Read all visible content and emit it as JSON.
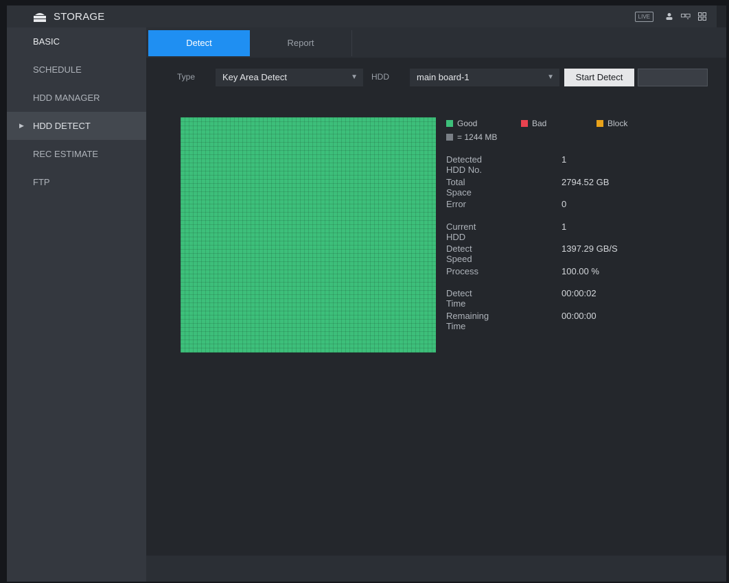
{
  "header": {
    "title": "STORAGE",
    "badge": "LIVE",
    "icons": [
      "storage-icon",
      "user-icon",
      "dual-screen-icon",
      "grid-icon"
    ],
    "colors": {
      "bar_bg": "#2e3238",
      "title_text": "#e8eaed"
    }
  },
  "sidebar": {
    "items": [
      {
        "label": "BASIC"
      },
      {
        "label": "SCHEDULE"
      },
      {
        "label": "HDD MANAGER"
      },
      {
        "label": "HDD DETECT",
        "active": true
      },
      {
        "label": "REC ESTIMATE"
      },
      {
        "label": "FTP"
      }
    ]
  },
  "tabs": [
    {
      "label": "Detect",
      "active": true
    },
    {
      "label": "Report",
      "active": false
    }
  ],
  "filters": {
    "type_label": "Type",
    "type_value": "Key Area Detect",
    "hdd_label": "HDD",
    "hdd_value": "main board-1",
    "start_label": "Start Detect",
    "stop_label": ""
  },
  "legend": {
    "good": "Good",
    "bad": "Bad",
    "block": "Block",
    "scale": "= 1244 MB",
    "colors": {
      "good": "#3dbf7a",
      "bad": "#e8424f",
      "block": "#e8a21a",
      "scale": "#7a7f86"
    }
  },
  "info": [
    {
      "label": "Detected HDD No.",
      "value": "1"
    },
    {
      "label": "Total Space",
      "value": "2794.52 GB"
    },
    {
      "label": "Error",
      "value": "0"
    },
    {
      "label": "Current HDD",
      "value": "1"
    },
    {
      "label": "Detect Speed",
      "value": "1397.29 GB/S"
    },
    {
      "label": "Process",
      "value": "100.00 %"
    },
    {
      "label": "Detect Time",
      "value": "00:00:02"
    },
    {
      "label": "Remaining Time",
      "value": "00:00:00"
    }
  ],
  "colors": {
    "accent": "#1f8ff2",
    "grid_good": "#3dbf7a"
  }
}
